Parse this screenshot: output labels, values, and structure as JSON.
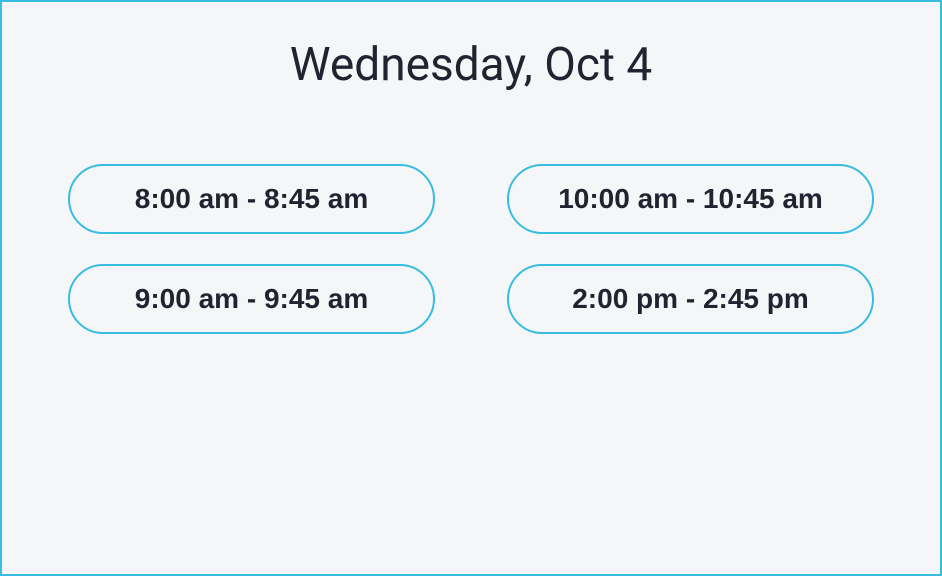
{
  "header": {
    "date_title": "Wednesday, Oct 4"
  },
  "slots": [
    {
      "label": "8:00 am - 8:45 am"
    },
    {
      "label": "10:00 am - 10:45 am"
    },
    {
      "label": "9:00 am - 9:45 am"
    },
    {
      "label": "2:00 pm - 2:45 pm"
    }
  ]
}
